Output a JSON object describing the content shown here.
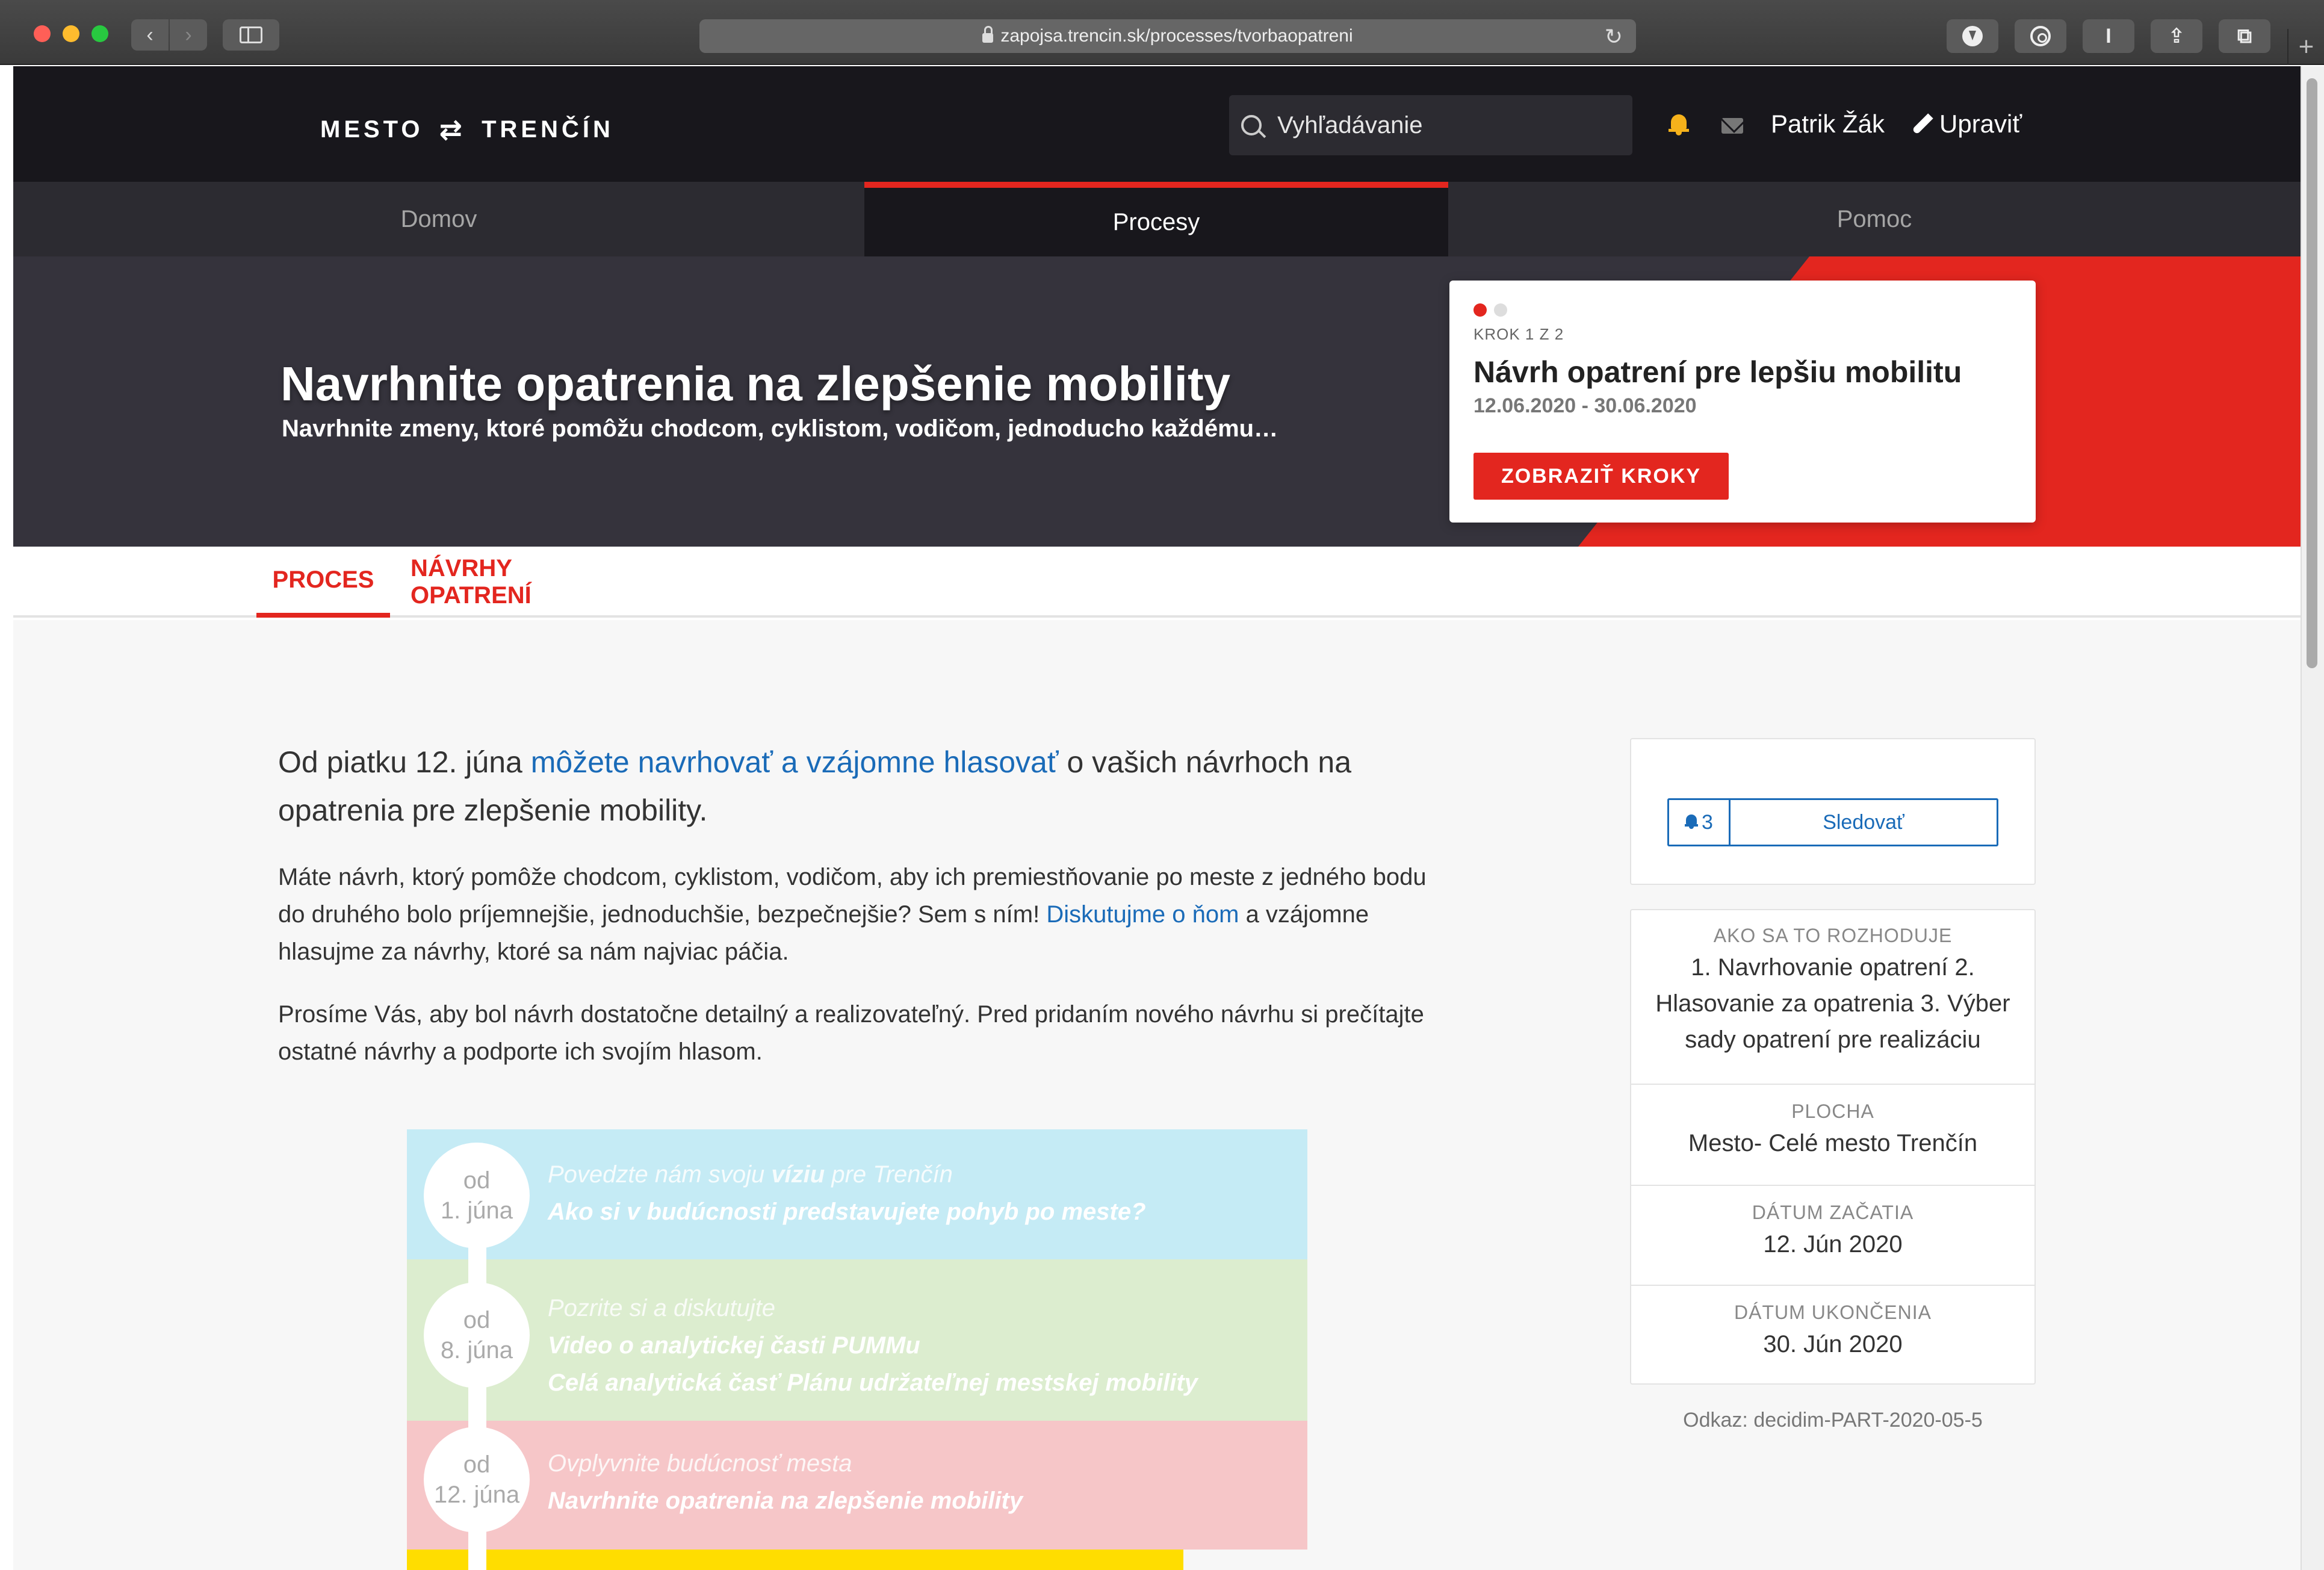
{
  "browser": {
    "url": "zapojsa.trencin.sk/processes/tvorbaopatreni"
  },
  "header": {
    "logo_left": "MESTO",
    "logo_right": "TRENČÍN",
    "search_placeholder": "Vyhľadávanie",
    "user_name": "Patrik Žák",
    "edit_label": "Upraviť"
  },
  "nav": {
    "tabs": [
      {
        "label": "Domov"
      },
      {
        "label": "Procesy"
      },
      {
        "label": "Pomoc"
      }
    ],
    "active": "Procesy"
  },
  "hero": {
    "title": "Navrhnite opatrenia na zlepšenie mobility",
    "subtitle": "Navrhnite zmeny, ktoré pomôžu chodcom, cyklistom, vodičom, jednoducho každému…",
    "step": {
      "counter": "KROK 1 Z 2",
      "title": "Návrh opatrení pre lepšiu mobilitu",
      "dates": "12.06.2020 - 30.06.2020",
      "button_label": "ZOBRAZIŤ KROKY"
    },
    "colors": {
      "accent": "#e3261f",
      "hero_bg": "#35333c"
    }
  },
  "content_tabs": [
    {
      "label": "PROCES"
    },
    {
      "label": "NÁVRHY OPATRENÍ"
    }
  ],
  "intro": {
    "lead_before": "Od piatku 12. júna ",
    "lead_link": "môžete navrhovať a vzájomne hlasovať",
    "lead_after": " o vašich návrhoch na opatrenia pre zlepšenie mobility.",
    "p1_before": "Máte návrh, ktorý pomôže chodcom, cyklistom, vodičom, aby ich premiestňovanie po meste z jedného bodu do druhého bolo príjemnejšie, jednoduchšie, bezpečnejšie? Sem s ním! ",
    "p1_link": "Diskutujme o ňom",
    "p1_after": " a vzájomne hlasujme za návrhy, ktoré sa nám najviac páčia.",
    "p2": "Prosíme Vás, aby bol návrh dostatočne detailný a realizovateľný. Pred pridaním nového návrhu si prečítajte ostatné návrhy a podporte ich svojím hlasom."
  },
  "timeline": [
    {
      "od": "od",
      "date": "1. júna",
      "lead_a": "Povedzte nám svoju ",
      "lead_b": "víziu",
      "lead_c": " pre Trenčín",
      "lines": [
        "Ako si v budúcnosti predstavujete pohyb po meste?"
      ]
    },
    {
      "od": "od",
      "date": "8. júna",
      "lead": "Pozrite si a diskutujte",
      "lines": [
        "Video o analytickej časti PUMMu",
        "Celá analytická časť Plánu udržateľnej mestskej mobility"
      ]
    },
    {
      "od": "od",
      "date": "12. júna",
      "lead": "Ovplyvnite budúcnosť mesta",
      "lines": [
        "Navrhnite opatrenia na zlepšenie mobility"
      ]
    }
  ],
  "sidebar": {
    "follow_count": "3",
    "follow_label": "Sledovať",
    "meta": [
      {
        "label": "AKO SA TO ROZHODUJE",
        "value": "1. Navrhovanie opatrení 2. Hlasovanie za opatrenia 3. Výber sady opatrení pre realizáciu"
      },
      {
        "label": "PLOCHA",
        "value": "Mesto- Celé mesto Trenčín"
      },
      {
        "label": "DÁTUM ZAČATIA",
        "value": "12. Jún 2020"
      },
      {
        "label": "DÁTUM UKONČENIA",
        "value": "30. Jún 2020"
      }
    ],
    "reference": "Odkaz: decidim-PART-2020-05-5"
  }
}
